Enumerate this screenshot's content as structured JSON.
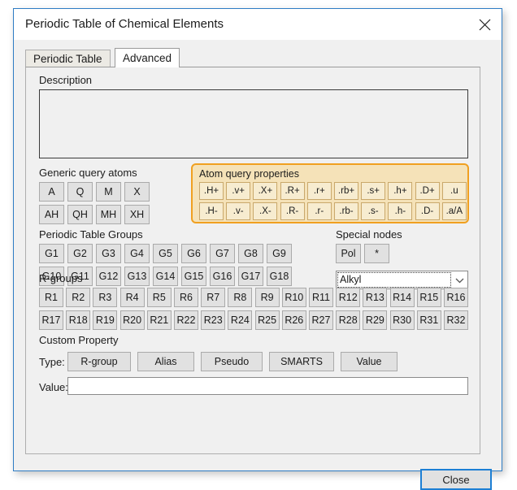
{
  "window": {
    "title": "Periodic Table of Chemical Elements",
    "close_icon": "close-icon"
  },
  "tabs": [
    {
      "label": "Periodic Table",
      "active": false
    },
    {
      "label": "Advanced",
      "active": true
    }
  ],
  "description": {
    "label": "Description",
    "value": ""
  },
  "generic_query_atoms": {
    "label": "Generic query atoms",
    "rows": [
      [
        "A",
        "Q",
        "M",
        "X"
      ],
      [
        "AH",
        "QH",
        "MH",
        "XH"
      ]
    ]
  },
  "atom_query_properties": {
    "label": "Atom query properties",
    "highlight_border_color": "#f0a020",
    "highlight_background_color": "#f5e2b8",
    "rows": [
      [
        ".H+",
        ".v+",
        ".X+",
        ".R+",
        ".r+",
        ".rb+",
        ".s+",
        ".h+",
        ".D+",
        ".u"
      ],
      [
        ".H-",
        ".v-",
        ".X-",
        ".R-",
        ".r-",
        ".rb-",
        ".s-",
        ".h-",
        ".D-",
        ".a/A"
      ]
    ]
  },
  "periodic_table_groups": {
    "label": "Periodic Table Groups",
    "rows": [
      [
        "G1",
        "G2",
        "G3",
        "G4",
        "G5",
        "G6",
        "G7",
        "G8",
        "G9"
      ],
      [
        "G10",
        "G11",
        "G12",
        "G13",
        "G14",
        "G15",
        "G16",
        "G17",
        "G18"
      ]
    ]
  },
  "special_nodes": {
    "label": "Special nodes",
    "buttons": [
      "Pol",
      "*"
    ],
    "dropdown": {
      "selected": "Alkyl",
      "arrow_icon": "chevron-down-icon"
    }
  },
  "r_groups": {
    "label": "R-groups",
    "rows": [
      [
        "R1",
        "R2",
        "R3",
        "R4",
        "R5",
        "R6",
        "R7",
        "R8",
        "R9",
        "R10",
        "R11",
        "R12",
        "R13",
        "R14",
        "R15",
        "R16"
      ],
      [
        "R17",
        "R18",
        "R19",
        "R20",
        "R21",
        "R22",
        "R23",
        "R24",
        "R25",
        "R26",
        "R27",
        "R28",
        "R29",
        "R30",
        "R31",
        "R32"
      ]
    ]
  },
  "custom_property": {
    "label": "Custom Property",
    "type_label": "Type:",
    "type_buttons": [
      "R-group",
      "Alias",
      "Pseudo",
      "SMARTS",
      "Value"
    ],
    "value_label": "Value:",
    "value": "",
    "value_placeholder": ""
  },
  "footer": {
    "close_label": "Close"
  }
}
